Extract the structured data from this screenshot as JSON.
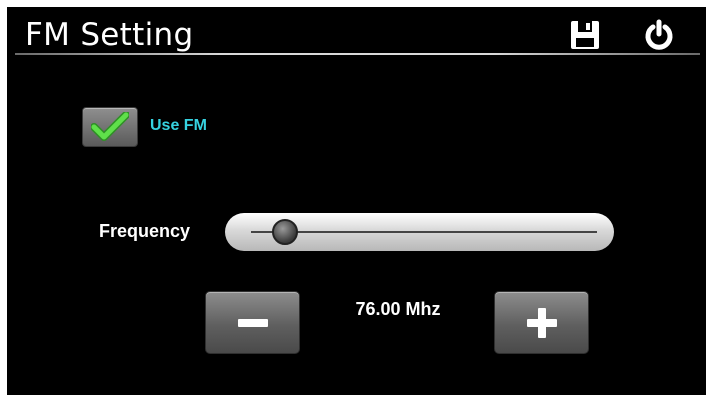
{
  "header": {
    "title": "FM Setting",
    "save_icon": "floppy-disk-icon",
    "power_icon": "power-icon"
  },
  "fm": {
    "use_fm_label": "Use FM",
    "use_fm_checked": true,
    "checkmark_color": "#4cd53a"
  },
  "frequency": {
    "label": "Frequency",
    "value_display": "76.00 Mhz",
    "slider_fraction": 0.06
  },
  "stepper": {
    "minus_icon": "minus-icon",
    "plus_icon": "plus-icon"
  },
  "colors": {
    "label_accent": "#36d2e0",
    "background": "#000000"
  }
}
